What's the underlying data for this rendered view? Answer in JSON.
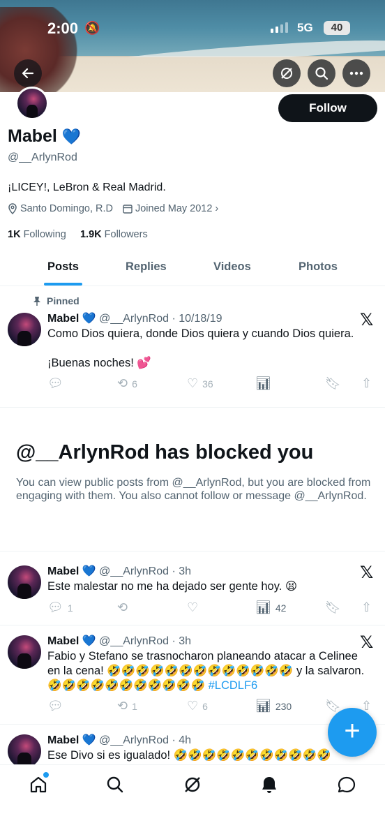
{
  "status_bar": {
    "time": "2:00",
    "network": "5G",
    "battery": "40"
  },
  "header": {
    "back_icon": "arrow-left-icon",
    "grok_icon": "grok-icon",
    "search_icon": "search-icon",
    "more_icon": "more-icon"
  },
  "profile": {
    "name": "Mabel",
    "name_emoji": "💙",
    "handle": "@__ArlynRod",
    "follow_label": "Follow",
    "bio": "¡LICEY!, LeBron & Real Madrid.",
    "location": "Santo Domingo, R.D",
    "joined": "Joined May 2012",
    "following_count": "1K",
    "following_label": "Following",
    "followers_count": "1.9K",
    "followers_label": "Followers"
  },
  "tabs": [
    {
      "label": "Posts",
      "active": true
    },
    {
      "label": "Replies",
      "active": false
    },
    {
      "label": "Videos",
      "active": false
    },
    {
      "label": "Photos",
      "active": false
    }
  ],
  "pinned_label": "Pinned",
  "tweets": [
    {
      "name": "Mabel 💙",
      "handle_time": "@__ArlynRod · 10/18/19",
      "text_line1": "Como Dios quiera, donde Dios quiera y cuando Dios quiera.",
      "text_line2": "¡Buenas noches! 💕",
      "replies": "",
      "reposts": "6",
      "likes": "36",
      "views": ""
    },
    {
      "name": "Mabel 💙",
      "handle_time": "@__ArlynRod · 3h",
      "text_line1": "Este malestar no me ha dejado ser gente hoy. 😫",
      "replies": "1",
      "reposts": "",
      "likes": "",
      "views": "42"
    },
    {
      "name": "Mabel 💙",
      "handle_time": "@__ArlynRod · 3h",
      "text_line1": "Fabio y Stefano se trasnocharon planeando atacar a Celinee",
      "text_line2": "en la cena! 🤣🤣🤣🤣🤣🤣🤣🤣🤣🤣🤣🤣🤣 y la salvaron.",
      "text_line3": "🤣🤣🤣🤣🤣🤣🤣🤣🤣🤣🤣",
      "hashtag": "#LCDLF6",
      "replies": "",
      "reposts": "1",
      "likes": "6",
      "views": "230"
    },
    {
      "name": "Mabel 💙",
      "handle_time": "@__ArlynRod · 4h",
      "text_line1": "Ese Divo si es igualado! 🤣🤣🤣🤣🤣🤣🤣🤣🤣🤣🤣"
    }
  ],
  "blocked": {
    "title": "@__ArlynRod has blocked you",
    "body": "You can view public posts from @__ArlynRod, but you are blocked from engaging with them. You also cannot follow or message @__ArlynRod."
  },
  "colors": {
    "accent": "#1d9bf0",
    "text": "#0f1419",
    "muted": "#536471"
  }
}
